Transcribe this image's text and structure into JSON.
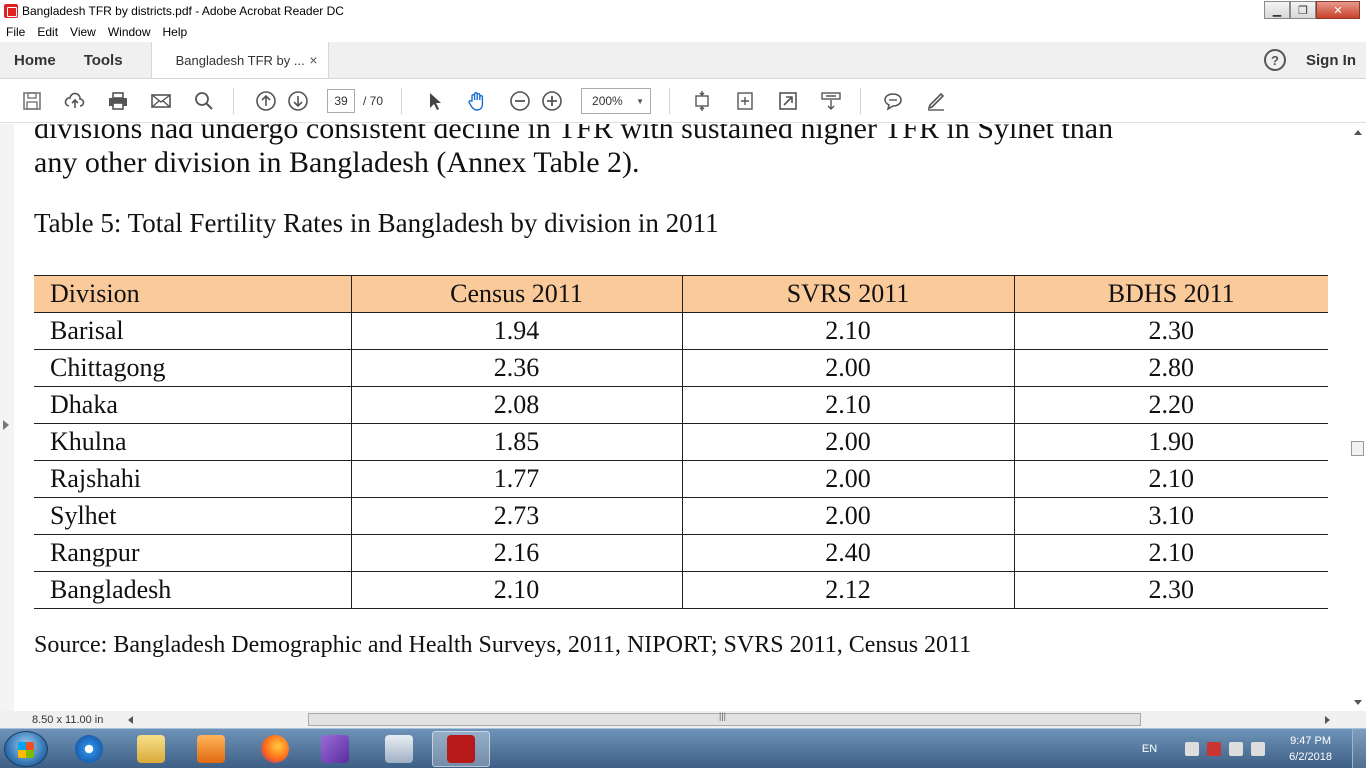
{
  "window": {
    "title": "Bangladesh TFR by districts.pdf - Adobe Acrobat Reader DC",
    "minimize": "▁",
    "maximize": "❐",
    "close": "✕"
  },
  "menu": [
    "File",
    "Edit",
    "View",
    "Window",
    "Help"
  ],
  "tabs": {
    "home": "Home",
    "tools": "Tools",
    "document": "Bangladesh TFR by ...",
    "close": "×",
    "help": "?",
    "sign_in": "Sign In"
  },
  "toolbar": {
    "page_current": "39",
    "page_total": "/ 70",
    "zoom": "200%",
    "icons": [
      "save-icon",
      "upload-icon",
      "print-icon",
      "email-icon",
      "search-icon",
      "prev-page-icon",
      "next-page-icon",
      "select-icon",
      "hand-icon",
      "zoom-out-icon",
      "zoom-in-icon",
      "fit-page-icon",
      "rotate-icon",
      "fullscreen-icon",
      "scroll-mode-icon",
      "comment-icon",
      "sign-icon"
    ]
  },
  "document": {
    "partial_line": "divisions had undergo consistent decline in TFR with sustained higher TFR in Sylhet than",
    "para_line": "any other division in Bangladesh (Annex Table 2).",
    "caption": "Table 5: Total Fertility Rates in Bangladesh by division in 2011",
    "table": {
      "headers": [
        "Division",
        "Census 2011",
        "SVRS 2011",
        "BDHS 2011"
      ],
      "rows": [
        [
          "Barisal",
          "1.94",
          "2.10",
          "2.30"
        ],
        [
          "Chittagong",
          "2.36",
          "2.00",
          "2.80"
        ],
        [
          "Dhaka",
          "2.08",
          "2.10",
          "2.20"
        ],
        [
          "Khulna",
          "1.85",
          "2.00",
          "1.90"
        ],
        [
          "Rajshahi",
          "1.77",
          "2.00",
          "2.10"
        ],
        [
          "Sylhet",
          "2.73",
          "2.00",
          "3.10"
        ],
        [
          "Rangpur",
          "2.16",
          "2.40",
          "2.10"
        ],
        [
          "Bangladesh",
          "2.10",
          "2.12",
          "2.30"
        ]
      ]
    },
    "source": "Source: Bangladesh Demographic and Health Surveys, 2011, NIPORT; SVRS 2011, Census 2011"
  },
  "status": {
    "page_size": "8.50 x 11.00 in"
  },
  "taskbar": {
    "apps": [
      "windows-explorer",
      "internet-explorer",
      "file-explorer",
      "media-player",
      "firefox",
      "visual-studio",
      "calculator",
      "acrobat-reader"
    ],
    "language": "EN",
    "time": "9:47 PM",
    "date": "6/2/2018"
  }
}
